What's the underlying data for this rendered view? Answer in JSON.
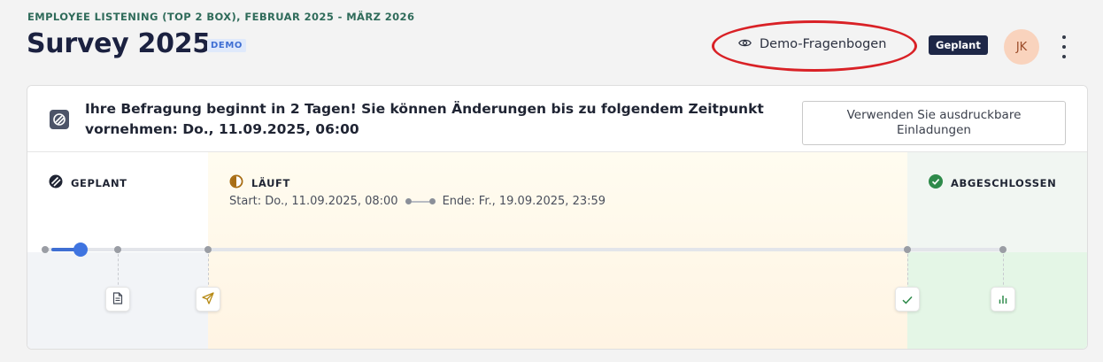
{
  "header": {
    "eyebrow": "EMPLOYEE LISTENING (TOP 2 BOX), FEBRUAR 2025 - MÄRZ 2026",
    "title": "Survey 2025",
    "demo_badge": "DEMO",
    "demo_link_label": "Demo-Fragenbogen",
    "status_badge": "Geplant",
    "avatar_initials": "JK"
  },
  "notice": {
    "text": "Ihre Befragung beginnt in 2 Tagen! Sie können Änderungen bis zu folgendem Zeitpunkt vornehmen: Do., 11.09.2025, 06:00",
    "button_label": "Verwenden Sie ausdruckbare Einladungen"
  },
  "timeline": {
    "phases": {
      "planned": "GEPLANT",
      "running": "LÄUFT",
      "done": "ABGESCHLOSSEN"
    },
    "start": "Start: Do., 11.09.2025, 08:00",
    "end": "Ende: Fr., 19.09.2025, 23:59",
    "progress_fraction": 0.04
  },
  "colors": {
    "accent": "#3f6fd3",
    "status_badge_bg": "#1e2747",
    "running_icon": "#b07a1e",
    "done_icon": "#2e8a4a",
    "highlight_annotation": "#d92126"
  },
  "icons": {
    "eye": "eye-icon",
    "planned": "striped-circle-icon",
    "running": "half-circle-icon",
    "done": "check-circle-icon",
    "doc": "document-icon",
    "send": "send-icon",
    "check": "check-icon",
    "chart": "bar-chart-icon"
  }
}
